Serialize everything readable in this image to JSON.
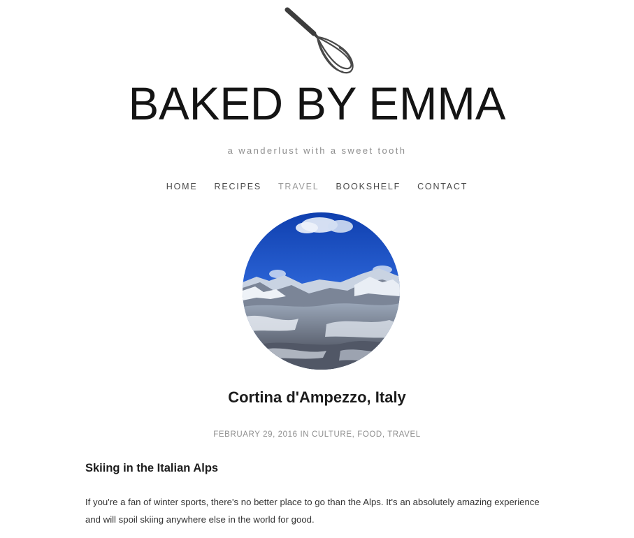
{
  "site": {
    "title": "BAKED BY EMMA",
    "tagline": "a wanderlust with a sweet tooth",
    "logo_icon": "whisk-icon"
  },
  "nav": {
    "items": [
      {
        "label": "HOME",
        "active": false
      },
      {
        "label": "RECIPES",
        "active": false
      },
      {
        "label": "TRAVEL",
        "active": true
      },
      {
        "label": "BOOKSHELF",
        "active": false
      },
      {
        "label": "CONTACT",
        "active": false
      }
    ]
  },
  "post": {
    "title": "Cortina d'Ampezzo, Italy",
    "date": "FEBRUARY 29, 2016",
    "in_label": "IN",
    "categories": [
      "CULTURE",
      "FOOD",
      "TRAVEL"
    ],
    "category_separator": ",",
    "section_heading": "Skiing in the Italian Alps",
    "paragraph": "If you're a fan of winter sports, there's no better place to go than the Alps. It's an absolutely amazing experience and will spoil skiing anywhere else in the world for good."
  },
  "colors": {
    "text_dark": "#141414",
    "nav_text": "#4a4a4a",
    "nav_active": "#9a9a9a",
    "meta_text": "#8f8f8f",
    "sky_blue": "#1f52c4"
  }
}
